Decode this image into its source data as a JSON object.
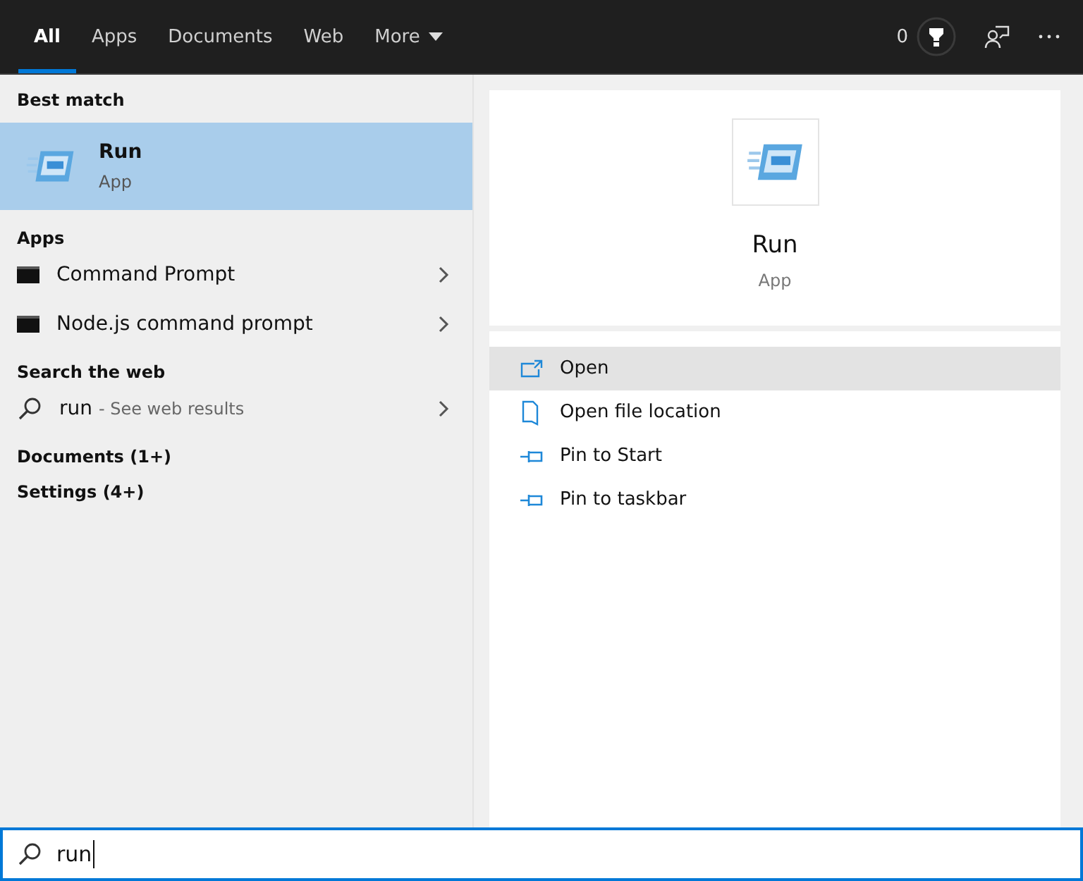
{
  "tabs": [
    {
      "label": "All",
      "selected": true,
      "dropdown": false
    },
    {
      "label": "Apps",
      "selected": false,
      "dropdown": false
    },
    {
      "label": "Documents",
      "selected": false,
      "dropdown": false
    },
    {
      "label": "Web",
      "selected": false,
      "dropdown": false
    },
    {
      "label": "More",
      "selected": false,
      "dropdown": true
    }
  ],
  "points": "0",
  "results": [
    {
      "heading": "Best match",
      "items": [
        {
          "kind": "best",
          "title": "Run",
          "subtitle": "App",
          "selected": true
        }
      ]
    },
    {
      "heading": "Apps",
      "items": [
        {
          "kind": "app",
          "title": "Command Prompt",
          "selected": false
        },
        {
          "kind": "app",
          "title": "Node.js command prompt",
          "selected": false
        }
      ]
    },
    {
      "heading": "Search the web",
      "items": [
        {
          "kind": "web",
          "title": "run",
          "hint": "- See web results",
          "selected": false
        }
      ]
    },
    {
      "heading": "Documents (1+)"
    },
    {
      "heading": "Settings (4+)"
    }
  ],
  "detail": {
    "title": "Run",
    "subtitle": "App",
    "actions": [
      {
        "kind": "open",
        "label": "Open",
        "selected": true
      },
      {
        "kind": "folder",
        "label": "Open file location",
        "selected": false
      },
      {
        "kind": "pin",
        "label": "Pin to Start",
        "selected": false
      },
      {
        "kind": "pin",
        "label": "Pin to taskbar",
        "selected": false
      }
    ]
  },
  "search": {
    "value": "run"
  }
}
